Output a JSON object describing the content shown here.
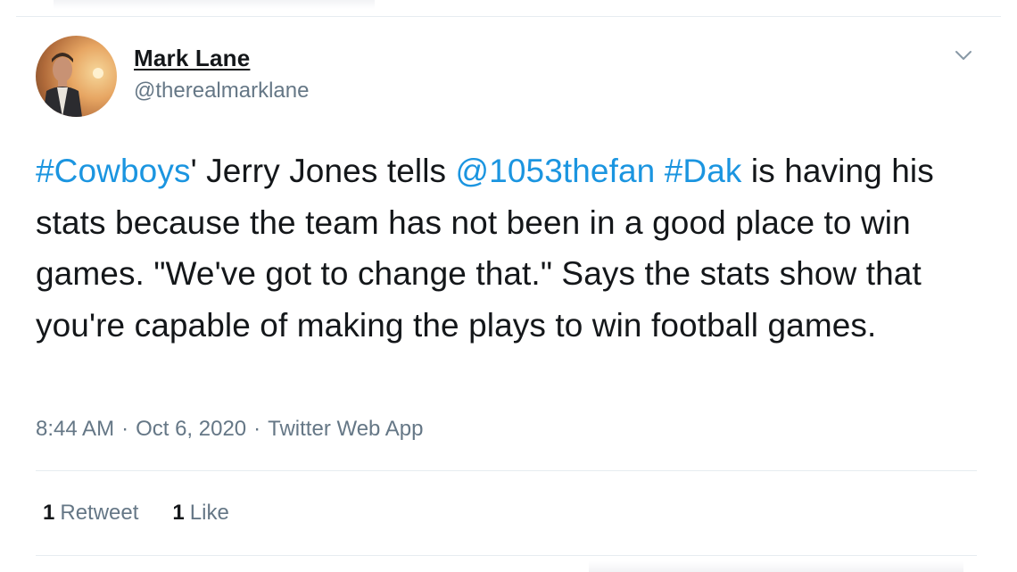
{
  "author": {
    "name": "Mark Lane",
    "handle": "@therealmarklane"
  },
  "tweet": {
    "segments": [
      {
        "text": "#Cowboys",
        "link": true
      },
      {
        "text": "' Jerry Jones tells ",
        "link": false
      },
      {
        "text": "@1053thefan",
        "link": true
      },
      {
        "text": " ",
        "link": false
      },
      {
        "text": "#Dak",
        "link": true
      },
      {
        "text": " is having his stats because the team has not been in a good place to win games. \"We've got to change that.\" Says the stats show that you're capable of making the plays to win football games.",
        "link": false
      }
    ]
  },
  "meta": {
    "time": "8:44 AM",
    "date": "Oct 6, 2020",
    "separator": "·",
    "source": "Twitter Web App"
  },
  "stats": {
    "retweets_count": "1",
    "retweets_label": "Retweet",
    "likes_count": "1",
    "likes_label": "Like"
  },
  "icons": {
    "menu": "chevron-down-icon"
  },
  "colors": {
    "link": "#1b95e0",
    "secondary_text": "#657786",
    "primary_text": "#14171a",
    "divider": "#e6ecf0"
  }
}
